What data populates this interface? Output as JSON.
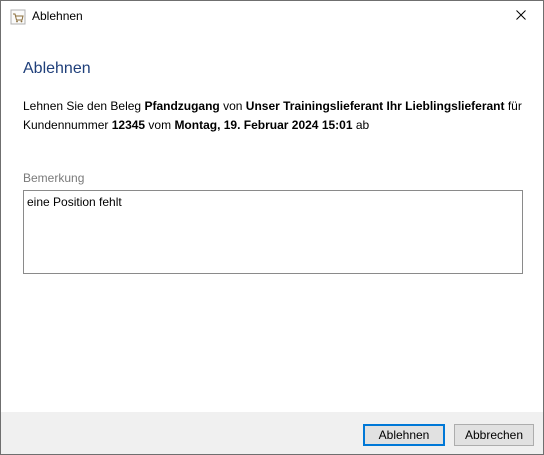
{
  "window": {
    "title": "Ablehnen",
    "app_icon": "cart-icon",
    "close_icon": "close-icon"
  },
  "dialog": {
    "heading": "Ablehnen",
    "message": {
      "part1": "Lehnen Sie den Beleg ",
      "document_type": "Pfandzugang",
      "part2": " von ",
      "supplier": "Unser Trainingslieferant Ihr Lieblingslieferant",
      "part3": " für Kundennummer ",
      "customer_number": "12345",
      "part4": " vom ",
      "date": "Montag, 19. Februar 2024 15:01",
      "part5": " ab"
    },
    "remark_label": "Bemerkung",
    "remark_value": "eine Position fehlt"
  },
  "buttons": {
    "reject": "Ablehnen",
    "cancel": "Abbrechen"
  },
  "colors": {
    "heading": "#1f3f7a",
    "accent": "#0078d7",
    "footer_bg": "#f0f0f0"
  }
}
